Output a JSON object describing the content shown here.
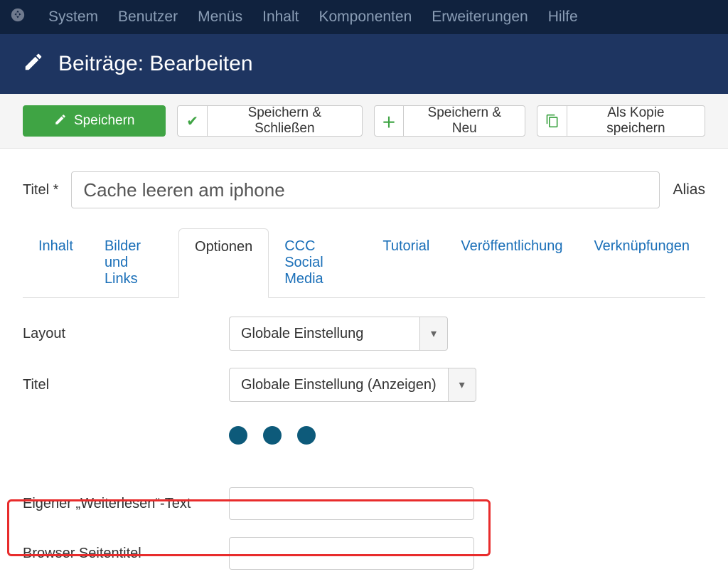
{
  "topnav": {
    "items": [
      "System",
      "Benutzer",
      "Menüs",
      "Inhalt",
      "Komponenten",
      "Erweiterungen",
      "Hilfe"
    ]
  },
  "page": {
    "title": "Beiträge: Bearbeiten"
  },
  "toolbar": {
    "save": "Speichern",
    "save_close": "Speichern & Schließen",
    "save_new": "Speichern & Neu",
    "save_copy": "Als Kopie speichern"
  },
  "form": {
    "title_label": "Titel *",
    "title_value": "Cache leeren am iphone",
    "alias_label": "Alias"
  },
  "tabs": [
    "Inhalt",
    "Bilder und Links",
    "Optionen",
    "CCC Social Media",
    "Tutorial",
    "Veröffentlichung",
    "Verknüpfungen"
  ],
  "active_tab": 2,
  "options": {
    "layout_label": "Layout",
    "layout_value": "Globale Einstellung",
    "titel_label": "Titel",
    "titel_value": "Globale Einstellung (Anzeigen)",
    "readmore_label": "Eigener „Weiterlesen“-Text",
    "readmore_value": "",
    "browser_title_label": "Browser Seitentitel",
    "browser_title_value": ""
  }
}
